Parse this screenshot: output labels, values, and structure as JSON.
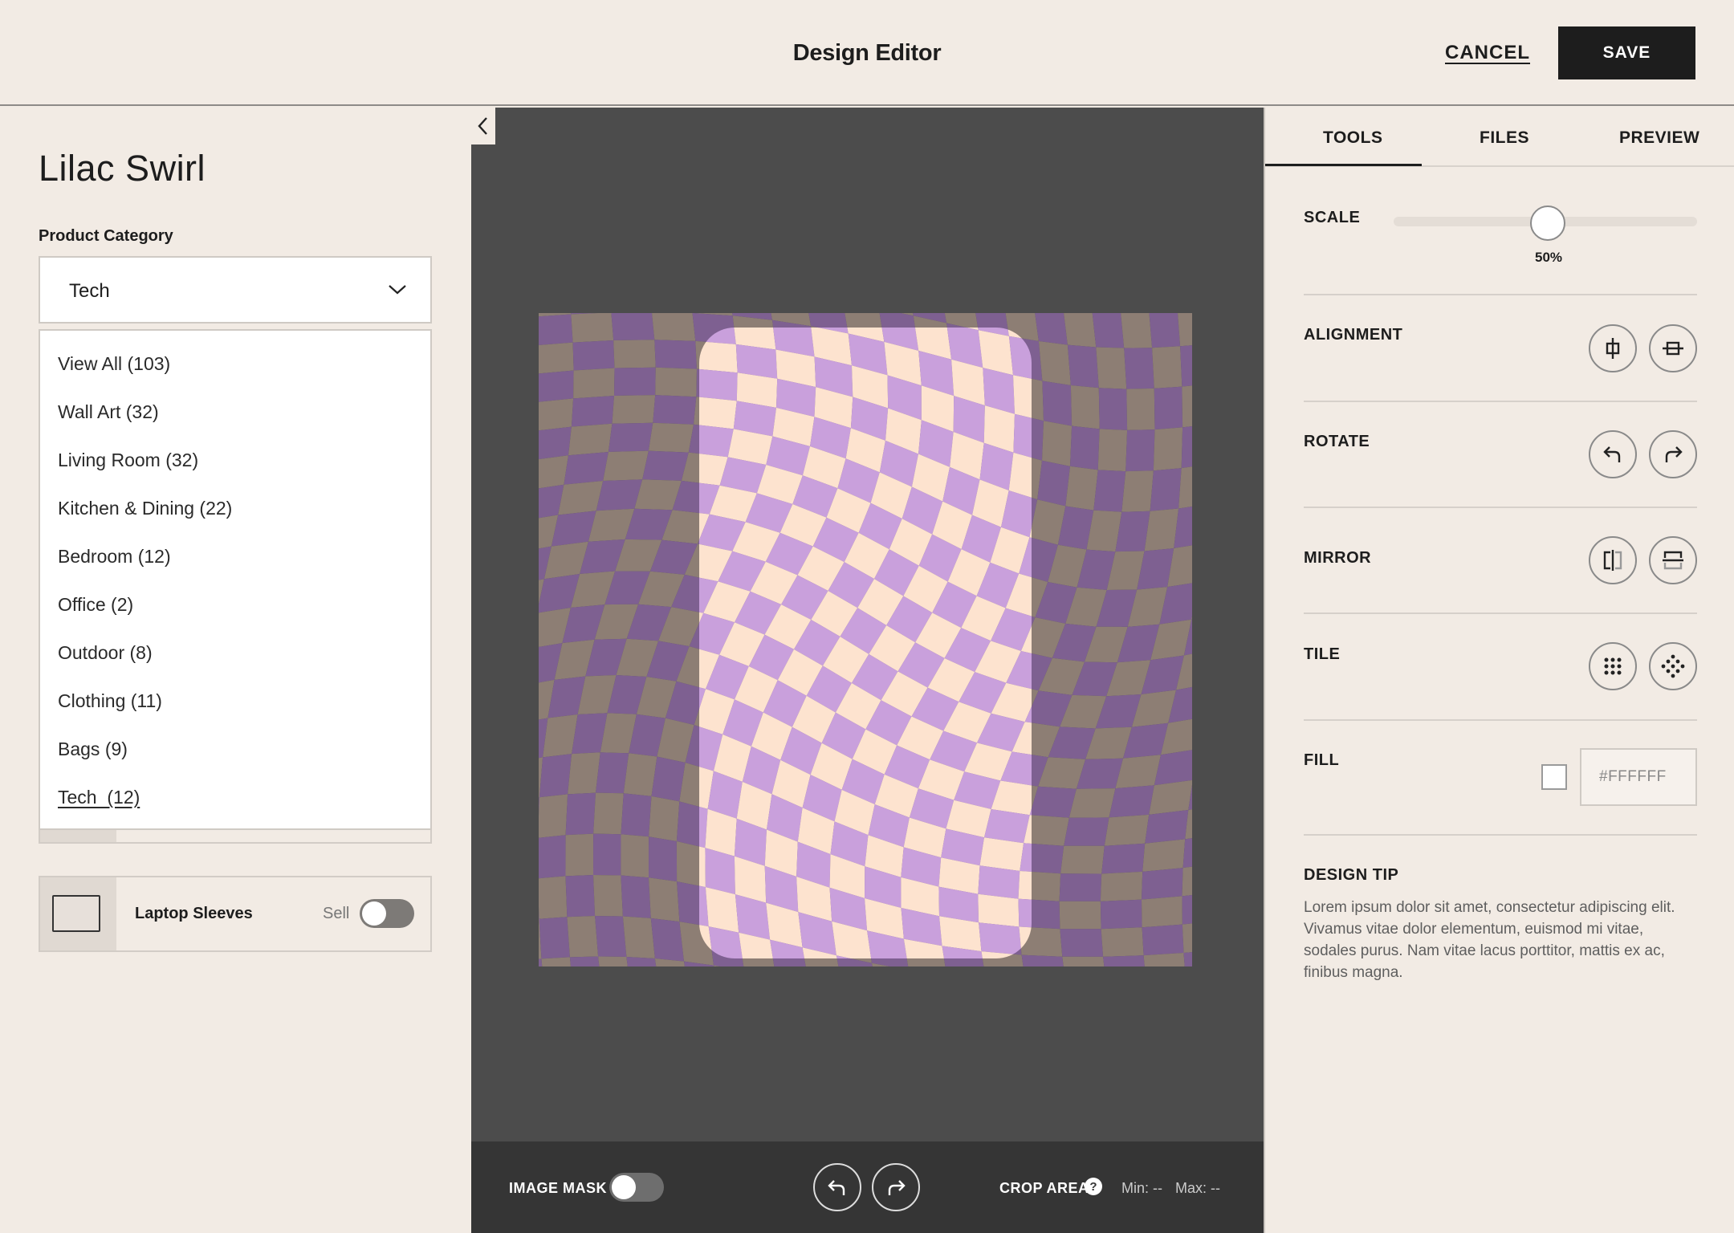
{
  "header": {
    "title": "Design Editor",
    "cancel_label": "CANCEL",
    "save_label": "SAVE"
  },
  "left_panel": {
    "product_name": "Lilac Swirl",
    "category_label": "Product Category",
    "category_value": "Tech",
    "dropdown_options": [
      "View All (103)",
      "Wall Art (32)",
      "Living Room (32)",
      "Kitchen & Dining (22)",
      "Bedroom (12)",
      "Office (2)",
      "Outdoor (8)",
      "Clothing (11)",
      "Bags (9)",
      "Tech  (12)"
    ],
    "selected_option_index": 9,
    "product_rows": [
      {
        "name": "Laptop Sleeves",
        "sell_label": "Sell",
        "sell_enabled": false
      }
    ]
  },
  "canvas": {
    "bottom_bar": {
      "image_mask_label": "IMAGE MASK",
      "image_mask_enabled": false,
      "crop_label": "CROP AREA",
      "help_glyph": "?",
      "min_label": "Min: --",
      "max_label": "Max: --"
    },
    "pattern_colors": {
      "lilac": "#c9a0dc",
      "peach": "#fde3cf",
      "outer_purple": "#7e6091",
      "outer_taupe": "#8d7e74"
    }
  },
  "right_panel": {
    "tabs": [
      "TOOLS",
      "FILES",
      "PREVIEW"
    ],
    "active_tab": "TOOLS",
    "scale": {
      "label": "SCALE",
      "value_label": "50%",
      "value": 50
    },
    "alignment_label": "ALIGNMENT",
    "rotate_label": "ROTATE",
    "mirror_label": "MIRROR",
    "tile_label": "TILE",
    "fill": {
      "label": "FILL",
      "value": "#FFFFFF"
    },
    "design_tip": {
      "label": "DESIGN TIP",
      "text": "Lorem ipsum dolor sit amet, consectetur adipiscing elit. Vivamus vitae dolor elementum, euismod mi vitae, sodales purus. Nam vitae lacus porttitor, mattis ex ac, finibus magna."
    }
  }
}
